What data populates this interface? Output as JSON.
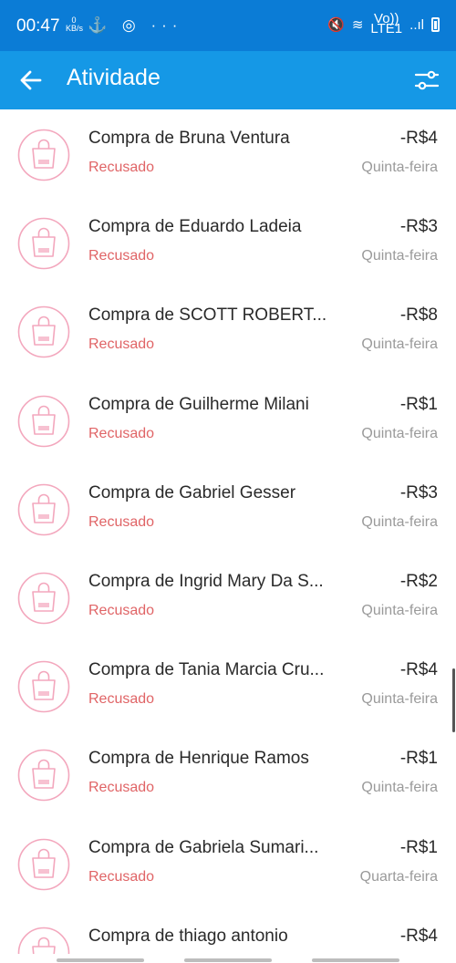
{
  "status_bar": {
    "time": "00:47",
    "kbs_value": "0",
    "kbs_unit": "KB/s",
    "left_icons": "⚓ ◎ ···",
    "volte_top": "Vo))",
    "volte_bottom": "LTE1",
    "signal": "..ıl",
    "mute": "🔇",
    "wifi": "≋"
  },
  "app_bar": {
    "back_icon": "arrow-left-icon",
    "title": "Atividade",
    "filter_icon": "sliders-icon"
  },
  "colors": {
    "status_bar": "#0b7cd6",
    "app_bar": "#1598e6",
    "refused": "#e06466",
    "icon_pink": "#f3a7bd"
  },
  "activity": [
    {
      "title": "Compra de Bruna Ventura",
      "status": "Recusado",
      "amount": "-R$4",
      "day": "Quinta-feira"
    },
    {
      "title": "Compra de Eduardo Ladeia",
      "status": "Recusado",
      "amount": "-R$3",
      "day": "Quinta-feira"
    },
    {
      "title": "Compra de SCOTT ROBERT...",
      "status": "Recusado",
      "amount": "-R$8",
      "day": "Quinta-feira"
    },
    {
      "title": "Compra de Guilherme Milani",
      "status": "Recusado",
      "amount": "-R$1",
      "day": "Quinta-feira"
    },
    {
      "title": "Compra de Gabriel Gesser",
      "status": "Recusado",
      "amount": "-R$3",
      "day": "Quinta-feira"
    },
    {
      "title": "Compra de Ingrid Mary Da S...",
      "status": "Recusado",
      "amount": "-R$2",
      "day": "Quinta-feira"
    },
    {
      "title": "Compra de Tania Marcia Cru...",
      "status": "Recusado",
      "amount": "-R$4",
      "day": "Quinta-feira"
    },
    {
      "title": "Compra de Henrique Ramos",
      "status": "Recusado",
      "amount": "-R$1",
      "day": "Quinta-feira"
    },
    {
      "title": "Compra de Gabriela Sumari...",
      "status": "Recusado",
      "amount": "-R$1",
      "day": "Quarta-feira"
    },
    {
      "title": "Compra de thiago antonio",
      "status": "",
      "amount": "-R$4",
      "day": ""
    }
  ]
}
